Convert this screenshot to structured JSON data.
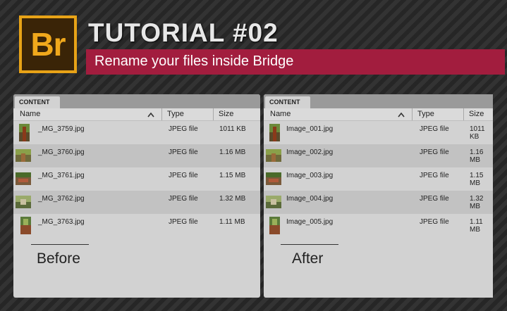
{
  "header": {
    "logo_text": "Br",
    "title": "TUTORIAL #02",
    "subtitle": "Rename your files inside Bridge",
    "accent_color": "#a21d3e",
    "logo_color": "#e8a317"
  },
  "panels": [
    {
      "tab_label": "CONTENT",
      "columns": {
        "name": "Name",
        "type": "Type",
        "size": "Size"
      },
      "rows": [
        {
          "name": "_MG_3759.jpg",
          "type": "JPEG file",
          "size": "1011 KB"
        },
        {
          "name": "_MG_3760.jpg",
          "type": "JPEG file",
          "size": "1.16 MB"
        },
        {
          "name": "_MG_3761.jpg",
          "type": "JPEG file",
          "size": "1.15 MB"
        },
        {
          "name": "_MG_3762.jpg",
          "type": "JPEG file",
          "size": "1.32 MB"
        },
        {
          "name": "_MG_3763.jpg",
          "type": "JPEG file",
          "size": "1.11 MB"
        }
      ],
      "caption": "Before"
    },
    {
      "tab_label": "CONTENT",
      "columns": {
        "name": "Name",
        "type": "Type",
        "size": "Size"
      },
      "rows": [
        {
          "name": "Image_001.jpg",
          "type": "JPEG file",
          "size": "1011 KB"
        },
        {
          "name": "Image_002.jpg",
          "type": "JPEG file",
          "size": "1.16 MB"
        },
        {
          "name": "Image_003.jpg",
          "type": "JPEG file",
          "size": "1.15 MB"
        },
        {
          "name": "Image_004.jpg",
          "type": "JPEG file",
          "size": "1.32 MB"
        },
        {
          "name": "Image_005.jpg",
          "type": "JPEG file",
          "size": "1.11 MB"
        }
      ],
      "caption": "After"
    }
  ]
}
